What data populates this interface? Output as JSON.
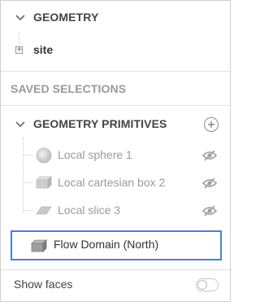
{
  "geometry_section": {
    "title": "GEOMETRY",
    "items": [
      {
        "label": "site"
      }
    ]
  },
  "saved_selections": {
    "title": "SAVED SELECTIONS"
  },
  "geometry_primitives": {
    "title": "GEOMETRY PRIMITIVES",
    "add_symbol": "+",
    "items": [
      {
        "label": "Local sphere 1",
        "icon": "sphere-icon",
        "hidden": true
      },
      {
        "label": "Local cartesian box 2",
        "icon": "box-icon",
        "hidden": true
      },
      {
        "label": "Local slice 3",
        "icon": "slice-icon",
        "hidden": true
      },
      {
        "label": "Flow Domain (North)",
        "icon": "box-icon",
        "selected": true
      }
    ]
  },
  "footer": {
    "show_faces_label": "Show faces",
    "show_faces_on": false
  },
  "colors": {
    "selection_border": "#4a80d0",
    "muted_text": "#9a9a9a"
  }
}
